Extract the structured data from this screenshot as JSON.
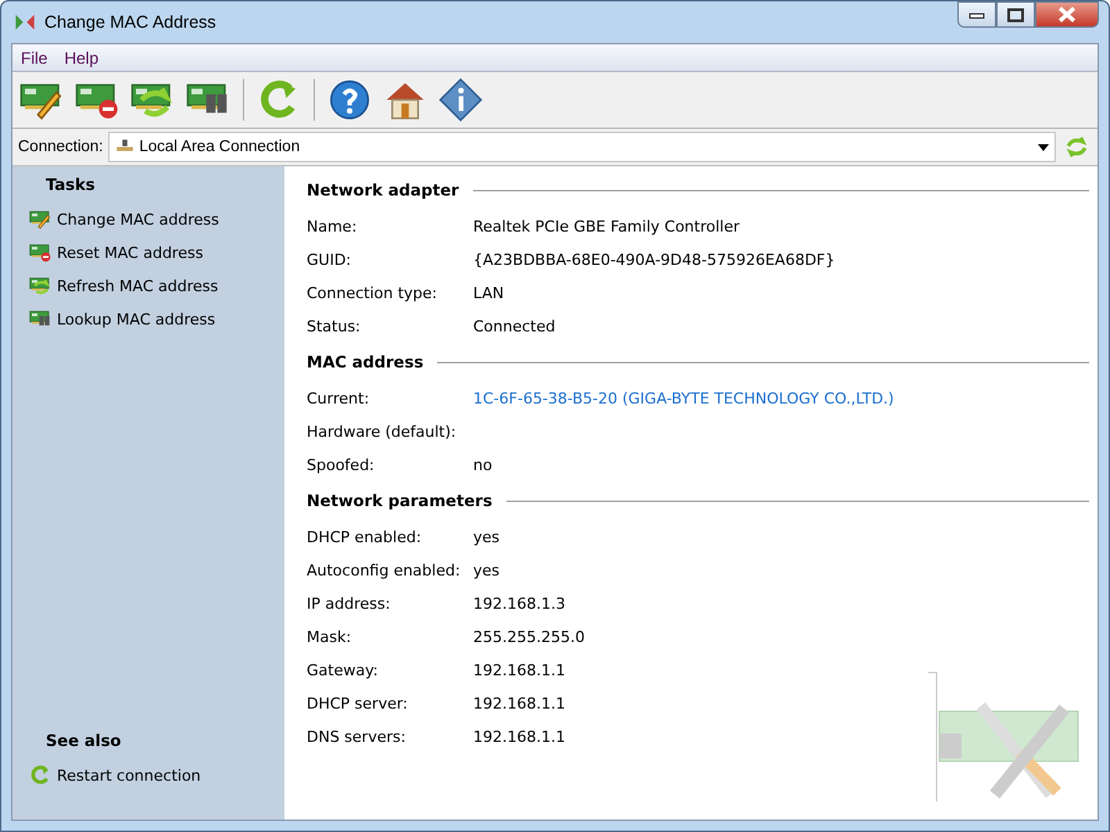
{
  "window": {
    "title": "Change MAC Address"
  },
  "menu": [
    "File",
    "Help"
  ],
  "connection": {
    "label": "Connection:",
    "value": "Local Area Connection"
  },
  "sidebar": {
    "tasks_title": "Tasks",
    "tasks": [
      {
        "label": "Change MAC address",
        "kind": "change"
      },
      {
        "label": "Reset MAC address",
        "kind": "reset"
      },
      {
        "label": "Refresh MAC address",
        "kind": "refresh"
      },
      {
        "label": "Lookup MAC address",
        "kind": "lookup"
      }
    ],
    "see_also_title": "See also",
    "see_also": [
      {
        "label": "Restart connection",
        "kind": "restart"
      }
    ]
  },
  "sections": [
    {
      "title": "Network adapter",
      "rows": [
        {
          "label": "Name:",
          "value": "Realtek PCIe GBE Family Controller",
          "kind": "text"
        },
        {
          "label": "GUID:",
          "value": "{A23BDBBA-68E0-490A-9D48-575926EA68DF}",
          "kind": "text"
        },
        {
          "label": "Connection type:",
          "value": "LAN",
          "kind": "text"
        },
        {
          "label": "Status:",
          "value": "Connected",
          "kind": "text"
        }
      ]
    },
    {
      "title": "MAC address",
      "rows": [
        {
          "label": "Current:",
          "value": "1C-6F-65-38-B5-20 (GIGA-BYTE TECHNOLOGY CO.,LTD.)",
          "kind": "link"
        },
        {
          "label": "Hardware (default):"
        },
        {
          "label": "Spoofed:",
          "value": "no",
          "kind": "text"
        }
      ]
    },
    {
      "title": "Network parameters",
      "rows": [
        {
          "label": "DHCP enabled:",
          "value": "yes",
          "kind": "text"
        },
        {
          "label": "Autoconfig enabled:",
          "value": "yes",
          "kind": "text"
        },
        {
          "label": "IP address:",
          "value": "192.168.1.3",
          "kind": "text"
        },
        {
          "label": "Mask:",
          "value": "255.255.255.0",
          "kind": "text"
        },
        {
          "label": "Gateway:",
          "value": "192.168.1.1",
          "kind": "text"
        },
        {
          "label": "DHCP server:",
          "value": "192.168.1.1",
          "kind": "text"
        },
        {
          "label": "DNS servers:",
          "value": "192.168.1.1",
          "kind": "text"
        }
      ]
    }
  ]
}
